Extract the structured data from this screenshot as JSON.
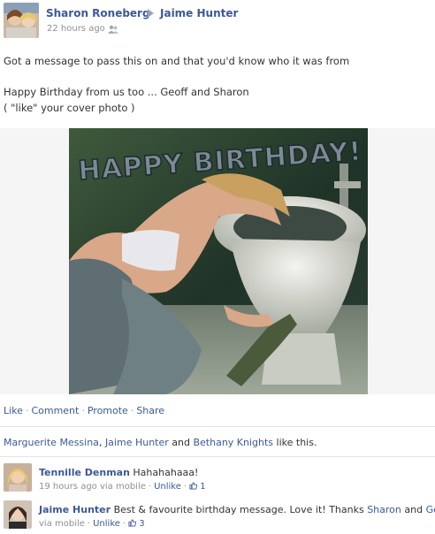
{
  "post": {
    "poster": "Sharon Roneberg",
    "recipient": "Jaime Hunter",
    "timestamp": "22 hours ago",
    "audience_icon": "friends-icon",
    "lines": [
      "Got a message to pass this on and that you'd know who it was from",
      "Happy Birthday from us too ... Geoff and Sharon",
      "( \"like\" your cover photo )"
    ],
    "photo_text": "HAPPY BIRTHDAY!"
  },
  "actions": {
    "like": "Like",
    "comment": "Comment",
    "promote": "Promote",
    "share": "Share",
    "separator": "·"
  },
  "likes": {
    "names": [
      "Marguerite Messina",
      "Jaime Hunter",
      "Bethany Knights"
    ],
    "sep1": ", ",
    "sep2": " and ",
    "suffix": " like this."
  },
  "comments": [
    {
      "author": "Tennille Denman",
      "text": "Hahahahaaa!",
      "time": "19 hours ago via mobile",
      "action": "Unlike",
      "likes": "1"
    },
    {
      "author": "Jaime Hunter",
      "text_before": "Best & favourite birthday message. Love it! Thanks ",
      "link1": "Sharon",
      "text_mid": " and ",
      "link2": "Geoff",
      "text_after": ".",
      "time": "via mobile",
      "action": "Unlike",
      "likes": "3"
    }
  ],
  "colors": {
    "link": "#3b5998",
    "meta": "#8f8f8f",
    "text": "#333333"
  }
}
